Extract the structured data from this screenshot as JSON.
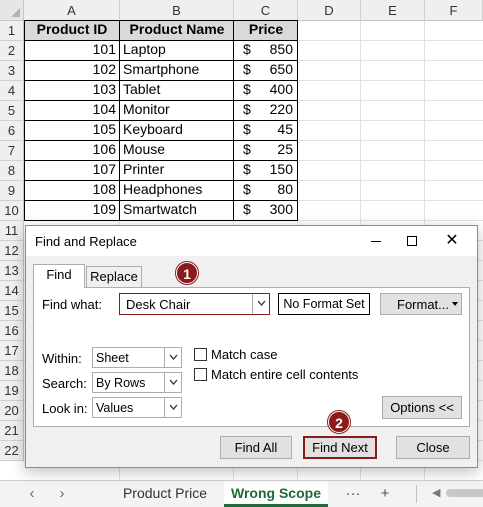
{
  "spreadsheet": {
    "columns": [
      "A",
      "B",
      "C",
      "D",
      "E",
      "F"
    ],
    "rows": [
      "1",
      "2",
      "3",
      "4",
      "5",
      "6",
      "7",
      "8",
      "9",
      "10",
      "11",
      "12",
      "13",
      "14",
      "15",
      "16",
      "17",
      "18",
      "19",
      "20",
      "21",
      "22"
    ],
    "table_headers": [
      "Product ID",
      "Product Name",
      "Price"
    ],
    "currency_symbol": "$",
    "table_rows": [
      {
        "id": "101",
        "name": "Laptop",
        "price": "850"
      },
      {
        "id": "102",
        "name": "Smartphone",
        "price": "650"
      },
      {
        "id": "103",
        "name": "Tablet",
        "price": "400"
      },
      {
        "id": "104",
        "name": "Monitor",
        "price": "220"
      },
      {
        "id": "105",
        "name": "Keyboard",
        "price": "45"
      },
      {
        "id": "106",
        "name": "Mouse",
        "price": "25"
      },
      {
        "id": "107",
        "name": "Printer",
        "price": "150"
      },
      {
        "id": "108",
        "name": "Headphones",
        "price": "80"
      },
      {
        "id": "109",
        "name": "Smartwatch",
        "price": "300"
      }
    ]
  },
  "sheet_tabs": {
    "nav_prev": "‹",
    "nav_next": "›",
    "tabs": [
      "Product Price",
      "Wrong Scope"
    ],
    "active_tab": "Wrong Scope",
    "more": "···",
    "add": "+"
  },
  "dialog": {
    "title": "Find and Replace",
    "close_glyph": "✕",
    "tab_find": "Find",
    "tab_replace": "Replace",
    "find_what_label": "Find what:",
    "find_what_value": "Desk Chair",
    "format_status": "No Format Set",
    "format_button": "Format...",
    "within_label": "Within:",
    "within_value": "Sheet",
    "search_label": "Search:",
    "search_value": "By Rows",
    "lookin_label": "Look in:",
    "lookin_value": "Values",
    "match_case_label": "Match case",
    "match_case_checked": false,
    "match_entire_label": "Match entire cell contents",
    "match_entire_checked": false,
    "options_button": "Options <<",
    "find_all_button": "Find All",
    "find_next_button": "Find Next",
    "close_button": "Close"
  },
  "callouts": [
    "1",
    "2"
  ],
  "colors": {
    "accent_red": "#8b1a1a",
    "excel_green": "#1e6b3a",
    "header_fill": "#d9d9d9",
    "dialog_bg": "#f0f0f0"
  }
}
